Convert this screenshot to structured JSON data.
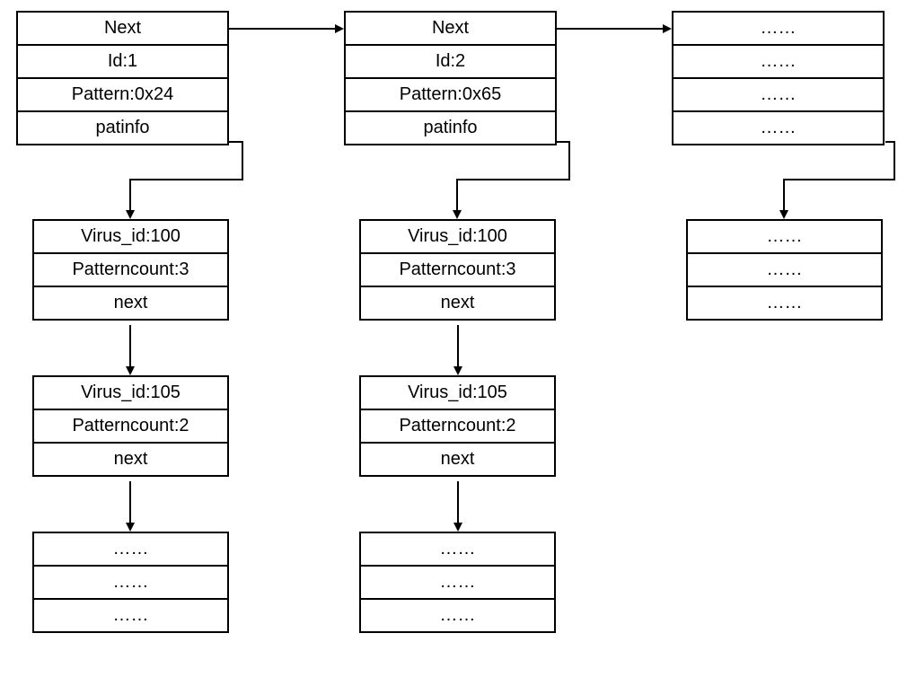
{
  "columns": [
    {
      "top": {
        "next": "Next",
        "id": "Id:1",
        "pattern": "Pattern:0x24",
        "patinfo": "patinfo"
      },
      "mid1": {
        "virus": "Virus_id:100",
        "count": "Patterncount:3",
        "next": "next"
      },
      "mid2": {
        "virus": "Virus_id:105",
        "count": "Patterncount:2",
        "next": "next"
      },
      "bottom": {
        "r1": "……",
        "r2": "……",
        "r3": "……"
      }
    },
    {
      "top": {
        "next": "Next",
        "id": "Id:2",
        "pattern": "Pattern:0x65",
        "patinfo": "patinfo"
      },
      "mid1": {
        "virus": "Virus_id:100",
        "count": "Patterncount:3",
        "next": "next"
      },
      "mid2": {
        "virus": "Virus_id:105",
        "count": "Patterncount:2",
        "next": "next"
      },
      "bottom": {
        "r1": "……",
        "r2": "……",
        "r3": "……"
      }
    },
    {
      "top": {
        "r1": "……",
        "r2": "……",
        "r3": "……",
        "r4": "……"
      },
      "mid1": {
        "r1": "……",
        "r2": "……",
        "r3": "……"
      }
    }
  ]
}
